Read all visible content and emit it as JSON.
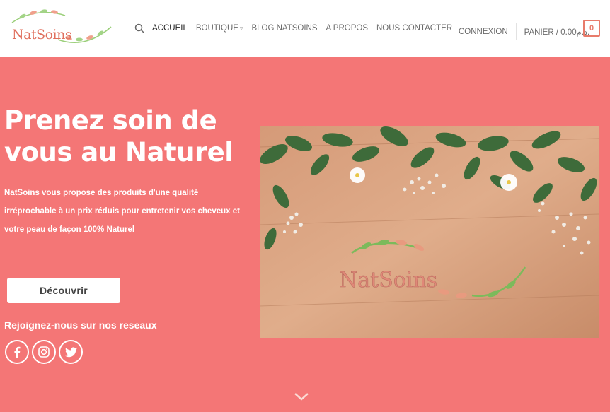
{
  "brand": {
    "name": "NatSoins"
  },
  "nav": {
    "items": [
      {
        "label": "ACCUEIL",
        "active": true
      },
      {
        "label": "BOUTIQUE",
        "dropdown": true
      },
      {
        "label": "BLOG NATSOINS"
      },
      {
        "label": "A PROPOS"
      },
      {
        "label": "NOUS CONTACTER"
      }
    ],
    "login": "CONNEXION",
    "cart": "PANIER / 0.00",
    "currency": "د.م.",
    "cart_count": "0"
  },
  "hero": {
    "title": "Prenez soin de vous au Naturel",
    "description": "NatSoins vous propose des produits d'une qualité irréprochable à un prix réduis pour entretenir vos cheveux et votre peau de façon 100% Naturel",
    "cta": "Découvrir",
    "social_title": "Rejoignez-nous sur nos reseaux",
    "social": [
      "facebook-icon",
      "instagram-icon",
      "twitter-icon"
    ],
    "image_text": "NatSoins"
  },
  "colors": {
    "hero_bg": "#f47676",
    "accent": "#e87b6b",
    "leaf_green": "#7cba5b"
  }
}
